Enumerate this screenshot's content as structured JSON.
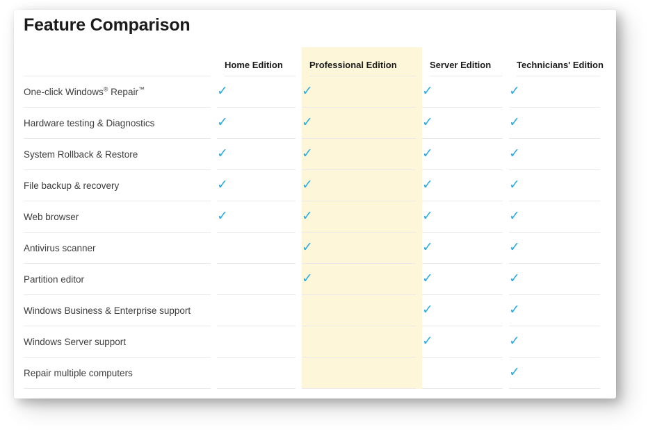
{
  "card": {
    "title": "Feature Comparison",
    "accent_color": "#29abe2",
    "highlight_color": "#fdf6d8",
    "rule_color": "#e9e9e9",
    "title_color": "#1b1b1b",
    "text_color": "#3d3d3d",
    "background_color": "#ffffff"
  },
  "table": {
    "feature_header": "",
    "columns": [
      {
        "label": "Home Edition",
        "highlighted": false
      },
      {
        "label": "Professional Edition",
        "highlighted": true
      },
      {
        "label": "Server Edition",
        "highlighted": false
      },
      {
        "label": "Technicians' Edition",
        "highlighted": false
      }
    ],
    "check_glyph": "✓",
    "rows": [
      {
        "feature": "One-click Windows® Repair™",
        "feature_parts": {
          "pre": "One-click Windows",
          "sup1": "®",
          "mid": " Repair",
          "sup2": "™"
        },
        "values": [
          true,
          true,
          true,
          true
        ]
      },
      {
        "feature": "Hardware testing & Diagnostics",
        "values": [
          true,
          true,
          true,
          true
        ]
      },
      {
        "feature": "System Rollback & Restore",
        "values": [
          true,
          true,
          true,
          true
        ]
      },
      {
        "feature": "File backup & recovery",
        "values": [
          true,
          true,
          true,
          true
        ]
      },
      {
        "feature": "Web browser",
        "values": [
          true,
          true,
          true,
          true
        ]
      },
      {
        "feature": "Antivirus scanner",
        "values": [
          false,
          true,
          true,
          true
        ]
      },
      {
        "feature": "Partition editor",
        "values": [
          false,
          true,
          true,
          true
        ]
      },
      {
        "feature": "Windows Business & Enterprise support",
        "values": [
          false,
          false,
          true,
          true
        ]
      },
      {
        "feature": "Windows Server support",
        "values": [
          false,
          false,
          true,
          true
        ]
      },
      {
        "feature": "Repair multiple computers",
        "values": [
          false,
          false,
          false,
          true
        ]
      }
    ]
  }
}
